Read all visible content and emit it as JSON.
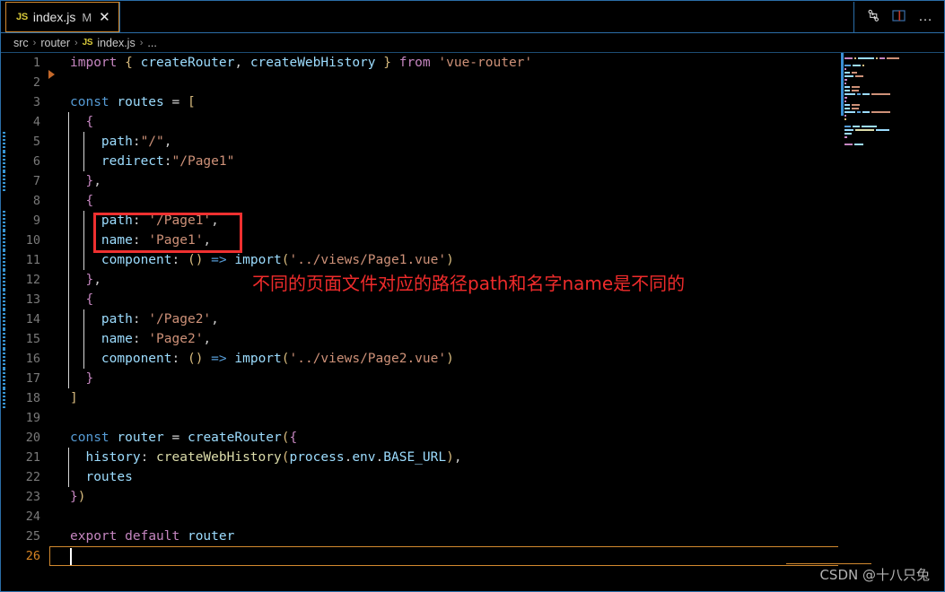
{
  "window": {
    "accent_border": "#2b6ea8",
    "background": "#000000"
  },
  "tab": {
    "filetype_badge": "JS",
    "label": "index.js",
    "dirty_indicator": "M",
    "close_glyph": "✕",
    "active_border_color": "#d2892f"
  },
  "tab_actions": {
    "compare_icon": "source-control-compare-icon",
    "split_icon": "split-editor-icon",
    "more_label": "…"
  },
  "breadcrumb": {
    "items": [
      "src",
      "router",
      "index.js",
      "..."
    ],
    "separator": "›",
    "file_badge": "JS"
  },
  "annotation": {
    "text": "不同的页面文件对应的路径path和名字name是不同的",
    "color": "#ef2b2b",
    "box_color": "#ef3030"
  },
  "watermark": {
    "text": "CSDN @十八只兔"
  },
  "editor": {
    "current_line": 26,
    "total_lines": 26,
    "lines": [
      {
        "n": 1,
        "tokens": [
          {
            "t": "import",
            "c": "t-key"
          },
          {
            "t": " ",
            "c": "t-plain"
          },
          {
            "t": "{",
            "c": "t-brace1"
          },
          {
            "t": " ",
            "c": "t-plain"
          },
          {
            "t": "createRouter",
            "c": "t-var"
          },
          {
            "t": ",",
            "c": "t-punct"
          },
          {
            "t": " ",
            "c": "t-plain"
          },
          {
            "t": "createWebHistory",
            "c": "t-var"
          },
          {
            "t": " ",
            "c": "t-plain"
          },
          {
            "t": "}",
            "c": "t-brace1"
          },
          {
            "t": " ",
            "c": "t-plain"
          },
          {
            "t": "from",
            "c": "t-key"
          },
          {
            "t": " ",
            "c": "t-plain"
          },
          {
            "t": "'vue-router'",
            "c": "t-str"
          }
        ],
        "indent": 0,
        "git": false
      },
      {
        "n": 2,
        "tokens": [],
        "indent": 0,
        "git": false
      },
      {
        "n": 3,
        "tokens": [
          {
            "t": "const",
            "c": "t-decl"
          },
          {
            "t": " ",
            "c": "t-plain"
          },
          {
            "t": "routes",
            "c": "t-var"
          },
          {
            "t": " ",
            "c": "t-plain"
          },
          {
            "t": "=",
            "c": "t-plain"
          },
          {
            "t": " ",
            "c": "t-plain"
          },
          {
            "t": "[",
            "c": "t-brace1"
          }
        ],
        "indent": 0,
        "git": false
      },
      {
        "n": 4,
        "tokens": [
          {
            "t": "  ",
            "c": "t-plain"
          },
          {
            "t": "{",
            "c": "t-brace2"
          }
        ],
        "indent": 1,
        "git": false
      },
      {
        "n": 5,
        "tokens": [
          {
            "t": "    ",
            "c": "t-plain"
          },
          {
            "t": "path",
            "c": "t-var"
          },
          {
            "t": ":",
            "c": "t-punct"
          },
          {
            "t": "\"/\"",
            "c": "t-str"
          },
          {
            "t": ",",
            "c": "t-punct"
          }
        ],
        "indent": 2,
        "git": true
      },
      {
        "n": 6,
        "tokens": [
          {
            "t": "    ",
            "c": "t-plain"
          },
          {
            "t": "redirect",
            "c": "t-var"
          },
          {
            "t": ":",
            "c": "t-punct"
          },
          {
            "t": "\"/Page1\"",
            "c": "t-str"
          }
        ],
        "indent": 2,
        "git": true
      },
      {
        "n": 7,
        "tokens": [
          {
            "t": "  ",
            "c": "t-plain"
          },
          {
            "t": "}",
            "c": "t-brace2"
          },
          {
            "t": ",",
            "c": "t-punct"
          }
        ],
        "indent": 1,
        "git": true
      },
      {
        "n": 8,
        "tokens": [
          {
            "t": "  ",
            "c": "t-plain"
          },
          {
            "t": "{",
            "c": "t-brace2"
          }
        ],
        "indent": 1,
        "git": false
      },
      {
        "n": 9,
        "tokens": [
          {
            "t": "    ",
            "c": "t-plain"
          },
          {
            "t": "path",
            "c": "t-var"
          },
          {
            "t": ":",
            "c": "t-punct"
          },
          {
            "t": " ",
            "c": "t-plain"
          },
          {
            "t": "'/Page1'",
            "c": "t-str"
          },
          {
            "t": ",",
            "c": "t-punct"
          }
        ],
        "indent": 2,
        "git": true
      },
      {
        "n": 10,
        "tokens": [
          {
            "t": "    ",
            "c": "t-plain"
          },
          {
            "t": "name",
            "c": "t-var"
          },
          {
            "t": ":",
            "c": "t-punct"
          },
          {
            "t": " ",
            "c": "t-plain"
          },
          {
            "t": "'Page1'",
            "c": "t-str"
          },
          {
            "t": ",",
            "c": "t-punct"
          }
        ],
        "indent": 2,
        "git": true
      },
      {
        "n": 11,
        "tokens": [
          {
            "t": "    ",
            "c": "t-plain"
          },
          {
            "t": "component",
            "c": "t-var"
          },
          {
            "t": ":",
            "c": "t-punct"
          },
          {
            "t": " ",
            "c": "t-plain"
          },
          {
            "t": "(",
            "c": "t-brace1"
          },
          {
            "t": ")",
            "c": "t-brace1"
          },
          {
            "t": " ",
            "c": "t-plain"
          },
          {
            "t": "=>",
            "c": "t-op"
          },
          {
            "t": " ",
            "c": "t-plain"
          },
          {
            "t": "import",
            "c": "t-var"
          },
          {
            "t": "(",
            "c": "t-brace1"
          },
          {
            "t": "'../views/Page1.vue'",
            "c": "t-str"
          },
          {
            "t": ")",
            "c": "t-brace1"
          }
        ],
        "indent": 2,
        "git": true
      },
      {
        "n": 12,
        "tokens": [
          {
            "t": "  ",
            "c": "t-plain"
          },
          {
            "t": "}",
            "c": "t-brace2"
          },
          {
            "t": ",",
            "c": "t-punct"
          }
        ],
        "indent": 1,
        "git": true
      },
      {
        "n": 13,
        "tokens": [
          {
            "t": "  ",
            "c": "t-plain"
          },
          {
            "t": "{",
            "c": "t-brace2"
          }
        ],
        "indent": 1,
        "git": true
      },
      {
        "n": 14,
        "tokens": [
          {
            "t": "    ",
            "c": "t-plain"
          },
          {
            "t": "path",
            "c": "t-var"
          },
          {
            "t": ":",
            "c": "t-punct"
          },
          {
            "t": " ",
            "c": "t-plain"
          },
          {
            "t": "'/Page2'",
            "c": "t-str"
          },
          {
            "t": ",",
            "c": "t-punct"
          }
        ],
        "indent": 2,
        "git": true
      },
      {
        "n": 15,
        "tokens": [
          {
            "t": "    ",
            "c": "t-plain"
          },
          {
            "t": "name",
            "c": "t-var"
          },
          {
            "t": ":",
            "c": "t-punct"
          },
          {
            "t": " ",
            "c": "t-plain"
          },
          {
            "t": "'Page2'",
            "c": "t-str"
          },
          {
            "t": ",",
            "c": "t-punct"
          }
        ],
        "indent": 2,
        "git": true
      },
      {
        "n": 16,
        "tokens": [
          {
            "t": "    ",
            "c": "t-plain"
          },
          {
            "t": "component",
            "c": "t-var"
          },
          {
            "t": ":",
            "c": "t-punct"
          },
          {
            "t": " ",
            "c": "t-plain"
          },
          {
            "t": "(",
            "c": "t-brace1"
          },
          {
            "t": ")",
            "c": "t-brace1"
          },
          {
            "t": " ",
            "c": "t-plain"
          },
          {
            "t": "=>",
            "c": "t-op"
          },
          {
            "t": " ",
            "c": "t-plain"
          },
          {
            "t": "import",
            "c": "t-var"
          },
          {
            "t": "(",
            "c": "t-brace1"
          },
          {
            "t": "'../views/Page2.vue'",
            "c": "t-str"
          },
          {
            "t": ")",
            "c": "t-brace1"
          }
        ],
        "indent": 2,
        "git": true
      },
      {
        "n": 17,
        "tokens": [
          {
            "t": "  ",
            "c": "t-plain"
          },
          {
            "t": "}",
            "c": "t-brace2"
          }
        ],
        "indent": 1,
        "git": true
      },
      {
        "n": 18,
        "tokens": [
          {
            "t": "]",
            "c": "t-brace1"
          }
        ],
        "indent": 0,
        "git": true
      },
      {
        "n": 19,
        "tokens": [],
        "indent": 0,
        "git": false
      },
      {
        "n": 20,
        "tokens": [
          {
            "t": "const",
            "c": "t-decl"
          },
          {
            "t": " ",
            "c": "t-plain"
          },
          {
            "t": "router",
            "c": "t-var"
          },
          {
            "t": " ",
            "c": "t-plain"
          },
          {
            "t": "=",
            "c": "t-plain"
          },
          {
            "t": " ",
            "c": "t-plain"
          },
          {
            "t": "createRouter",
            "c": "t-var"
          },
          {
            "t": "(",
            "c": "t-brace1"
          },
          {
            "t": "{",
            "c": "t-brace2"
          }
        ],
        "indent": 0,
        "git": false
      },
      {
        "n": 21,
        "tokens": [
          {
            "t": "  ",
            "c": "t-plain"
          },
          {
            "t": "history",
            "c": "t-var"
          },
          {
            "t": ":",
            "c": "t-punct"
          },
          {
            "t": " ",
            "c": "t-plain"
          },
          {
            "t": "createWebHistory",
            "c": "t-fn"
          },
          {
            "t": "(",
            "c": "t-brace1"
          },
          {
            "t": "process",
            "c": "t-var"
          },
          {
            "t": ".",
            "c": "t-punct"
          },
          {
            "t": "env",
            "c": "t-var"
          },
          {
            "t": ".",
            "c": "t-punct"
          },
          {
            "t": "BASE_URL",
            "c": "t-var"
          },
          {
            "t": ")",
            "c": "t-brace1"
          },
          {
            "t": ",",
            "c": "t-punct"
          }
        ],
        "indent": 1,
        "git": false
      },
      {
        "n": 22,
        "tokens": [
          {
            "t": "  ",
            "c": "t-plain"
          },
          {
            "t": "routes",
            "c": "t-var"
          }
        ],
        "indent": 1,
        "git": false
      },
      {
        "n": 23,
        "tokens": [
          {
            "t": "}",
            "c": "t-brace2"
          },
          {
            "t": ")",
            "c": "t-brace1"
          }
        ],
        "indent": 0,
        "git": false
      },
      {
        "n": 24,
        "tokens": [],
        "indent": 0,
        "git": false
      },
      {
        "n": 25,
        "tokens": [
          {
            "t": "export",
            "c": "t-key"
          },
          {
            "t": " ",
            "c": "t-plain"
          },
          {
            "t": "default",
            "c": "t-key"
          },
          {
            "t": " ",
            "c": "t-plain"
          },
          {
            "t": "router",
            "c": "t-var"
          }
        ],
        "indent": 0,
        "git": false
      },
      {
        "n": 26,
        "tokens": [],
        "indent": 0,
        "git": false
      }
    ]
  },
  "minimap": {
    "rows": [
      [
        [
          14,
          "#c586c0"
        ],
        [
          3,
          "#d7ba7d"
        ],
        [
          30,
          "#9cdcfe"
        ],
        [
          3,
          "#d7ba7d"
        ],
        [
          10,
          "#c586c0"
        ],
        [
          22,
          "#ce9178"
        ]
      ],
      [],
      [
        [
          12,
          "#569cd6"
        ],
        [
          14,
          "#9cdcfe"
        ],
        [
          3,
          "#d7ba7d"
        ]
      ],
      [
        [
          4,
          "#c586c0"
        ]
      ],
      [
        [
          10,
          "#9cdcfe"
        ],
        [
          10,
          "#ce9178"
        ]
      ],
      [
        [
          16,
          "#9cdcfe"
        ],
        [
          14,
          "#ce9178"
        ]
      ],
      [
        [
          5,
          "#c586c0"
        ]
      ],
      [
        [
          4,
          "#c586c0"
        ]
      ],
      [
        [
          10,
          "#9cdcfe"
        ],
        [
          14,
          "#ce9178"
        ]
      ],
      [
        [
          10,
          "#9cdcfe"
        ],
        [
          12,
          "#ce9178"
        ]
      ],
      [
        [
          20,
          "#9cdcfe"
        ],
        [
          6,
          "#569cd6"
        ],
        [
          12,
          "#9cdcfe"
        ],
        [
          34,
          "#ce9178"
        ]
      ],
      [
        [
          5,
          "#c586c0"
        ]
      ],
      [
        [
          4,
          "#c586c0"
        ]
      ],
      [
        [
          10,
          "#9cdcfe"
        ],
        [
          14,
          "#ce9178"
        ]
      ],
      [
        [
          10,
          "#9cdcfe"
        ],
        [
          12,
          "#ce9178"
        ]
      ],
      [
        [
          20,
          "#9cdcfe"
        ],
        [
          6,
          "#569cd6"
        ],
        [
          12,
          "#9cdcfe"
        ],
        [
          34,
          "#ce9178"
        ]
      ],
      [
        [
          4,
          "#c586c0"
        ]
      ],
      [
        [
          3,
          "#d7ba7d"
        ]
      ],
      [],
      [
        [
          12,
          "#569cd6"
        ],
        [
          13,
          "#9cdcfe"
        ],
        [
          26,
          "#9cdcfe"
        ]
      ],
      [
        [
          16,
          "#9cdcfe"
        ],
        [
          34,
          "#dcdcaa"
        ],
        [
          24,
          "#9cdcfe"
        ]
      ],
      [
        [
          13,
          "#9cdcfe"
        ]
      ],
      [
        [
          5,
          "#c586c0"
        ]
      ],
      [],
      [
        [
          14,
          "#c586c0"
        ],
        [
          16,
          "#9cdcfe"
        ]
      ]
    ]
  }
}
